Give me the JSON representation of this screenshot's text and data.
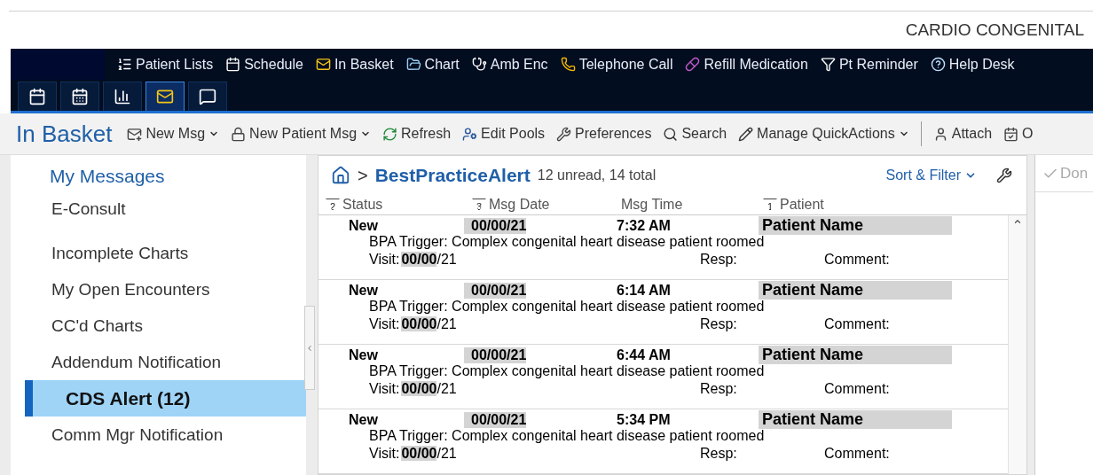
{
  "header": {
    "department": "CARDIO CONGENITAL"
  },
  "nav": {
    "items": [
      {
        "label": "Patient Lists"
      },
      {
        "label": "Schedule"
      },
      {
        "label": "In Basket"
      },
      {
        "label": "Chart"
      },
      {
        "label": "Amb Enc"
      },
      {
        "label": "Telephone Call"
      },
      {
        "label": "Refill Medication"
      },
      {
        "label": "Pt Reminder"
      },
      {
        "label": "Help Desk"
      }
    ],
    "tabs": [
      {
        "selected": false
      },
      {
        "selected": false
      },
      {
        "selected": false
      },
      {
        "selected": true
      },
      {
        "selected": false
      }
    ]
  },
  "toolbar": {
    "title": "In Basket",
    "items": [
      {
        "label": "New Msg",
        "dropdown": true
      },
      {
        "label": "New Patient Msg",
        "dropdown": true
      },
      {
        "label": "Refresh",
        "dropdown": false
      },
      {
        "label": "Edit Pools",
        "dropdown": false
      },
      {
        "label": "Preferences",
        "dropdown": false
      },
      {
        "label": "Search",
        "dropdown": false
      },
      {
        "label": "Manage QuickActions",
        "dropdown": true
      }
    ],
    "right_items": [
      {
        "label": "Attach"
      },
      {
        "label": "O"
      }
    ]
  },
  "sidebar": {
    "heading": "My Messages",
    "items": [
      {
        "label": "E-Consult",
        "selected": false,
        "gap_after": true
      },
      {
        "label": "Incomplete Charts",
        "selected": false,
        "gap_after": false
      },
      {
        "label": "My Open Encounters",
        "selected": false,
        "gap_after": false
      },
      {
        "label": "CC'd Charts",
        "selected": false,
        "gap_after": false
      },
      {
        "label": "Addendum Notification",
        "selected": false,
        "gap_after": false
      },
      {
        "label": "CDS Alert (12)",
        "selected": true,
        "gap_after": false
      },
      {
        "label": "Comm Mgr Notification",
        "selected": false,
        "gap_after": false
      }
    ]
  },
  "messages": {
    "breadcrumb": ">",
    "folder": "BestPracticeAlert",
    "counts": "12 unread, 14 total",
    "sort_filter": "Sort & Filter",
    "columns": [
      {
        "label": "Status",
        "sort": "2"
      },
      {
        "label": "Msg Date",
        "sort": "3"
      },
      {
        "label": "Msg Time"
      },
      {
        "label": "Patient",
        "sort": "1"
      }
    ],
    "rows": [
      {
        "status": "New",
        "unread": true,
        "date": "00/00/21",
        "time": "7:32 AM",
        "patient": "Patient Name",
        "trigger": "BPA Trigger: Complex congenital heart disease patient roomed",
        "visit_label": "Visit:",
        "visit": "**00/00**/21",
        "resp": "Resp:",
        "comment": "Comment:"
      },
      {
        "status": "New",
        "unread": true,
        "date": "00/00/21",
        "time": "6:14 AM",
        "patient": "Patient Name",
        "trigger": "BPA Trigger: Complex congenital heart disease patient roomed",
        "visit_label": "Visit:",
        "visit": "**00/00**/21",
        "resp": "Resp:",
        "comment": "Comment:"
      },
      {
        "status": "New",
        "unread": true,
        "date": "00/00/21",
        "time": "6:44 AM",
        "patient": "Patient Name",
        "trigger": "BPA Trigger: Complex congenital heart disease patient roomed",
        "visit_label": "Visit:",
        "visit": "**00/00**/21",
        "resp": "Resp:",
        "comment": "Comment:"
      },
      {
        "status": "New",
        "unread": true,
        "date": "00/00/21",
        "time": "5:34 PM",
        "patient": "Patient Name",
        "trigger": "BPA Trigger: Complex congenital heart disease patient roomed",
        "visit_label": "Visit:",
        "visit": "**00/00**/21",
        "resp": "Resp:",
        "comment": "Comment:"
      }
    ]
  },
  "detail": {
    "done": "Don"
  }
}
